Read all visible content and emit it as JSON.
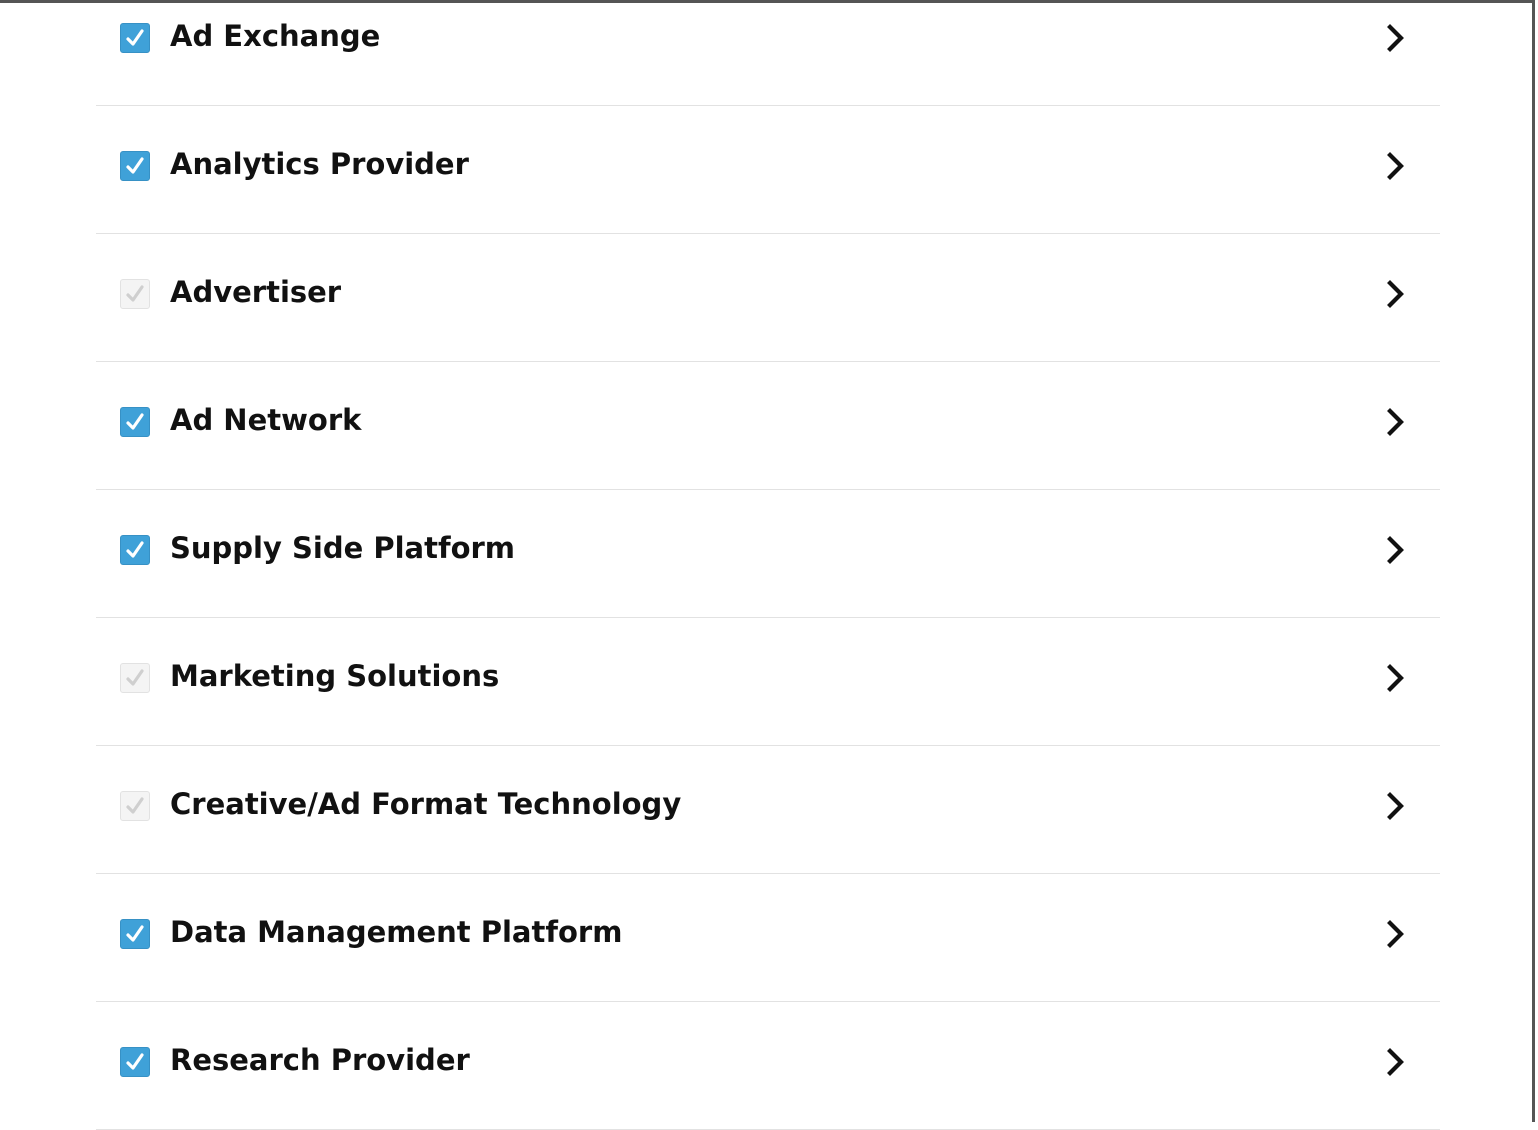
{
  "colors": {
    "checkbox_checked_bg": "#3fa1d8",
    "checkbox_unchecked_bg": "#f4f4f4",
    "checkmark_checked": "#ffffff",
    "checkmark_unchecked": "#cfcfcf",
    "label_text": "#111111",
    "divider": "#e2e2e2"
  },
  "list": {
    "items": [
      {
        "label": "Ad Exchange",
        "checked": true,
        "checkbox_icon": "checkmark-icon",
        "action_icon": "chevron-right-icon"
      },
      {
        "label": "Analytics Provider",
        "checked": true,
        "checkbox_icon": "checkmark-icon",
        "action_icon": "chevron-right-icon"
      },
      {
        "label": "Advertiser",
        "checked": false,
        "checkbox_icon": "checkmark-icon",
        "action_icon": "chevron-right-icon"
      },
      {
        "label": "Ad Network",
        "checked": true,
        "checkbox_icon": "checkmark-icon",
        "action_icon": "chevron-right-icon"
      },
      {
        "label": "Supply Side Platform",
        "checked": true,
        "checkbox_icon": "checkmark-icon",
        "action_icon": "chevron-right-icon"
      },
      {
        "label": "Marketing Solutions",
        "checked": false,
        "checkbox_icon": "checkmark-icon",
        "action_icon": "chevron-right-icon"
      },
      {
        "label": "Creative/Ad Format Technology",
        "checked": false,
        "checkbox_icon": "checkmark-icon",
        "action_icon": "chevron-right-icon"
      },
      {
        "label": "Data Management Platform",
        "checked": true,
        "checkbox_icon": "checkmark-icon",
        "action_icon": "chevron-right-icon"
      },
      {
        "label": "Research Provider",
        "checked": true,
        "checkbox_icon": "checkmark-icon",
        "action_icon": "chevron-right-icon"
      }
    ]
  }
}
